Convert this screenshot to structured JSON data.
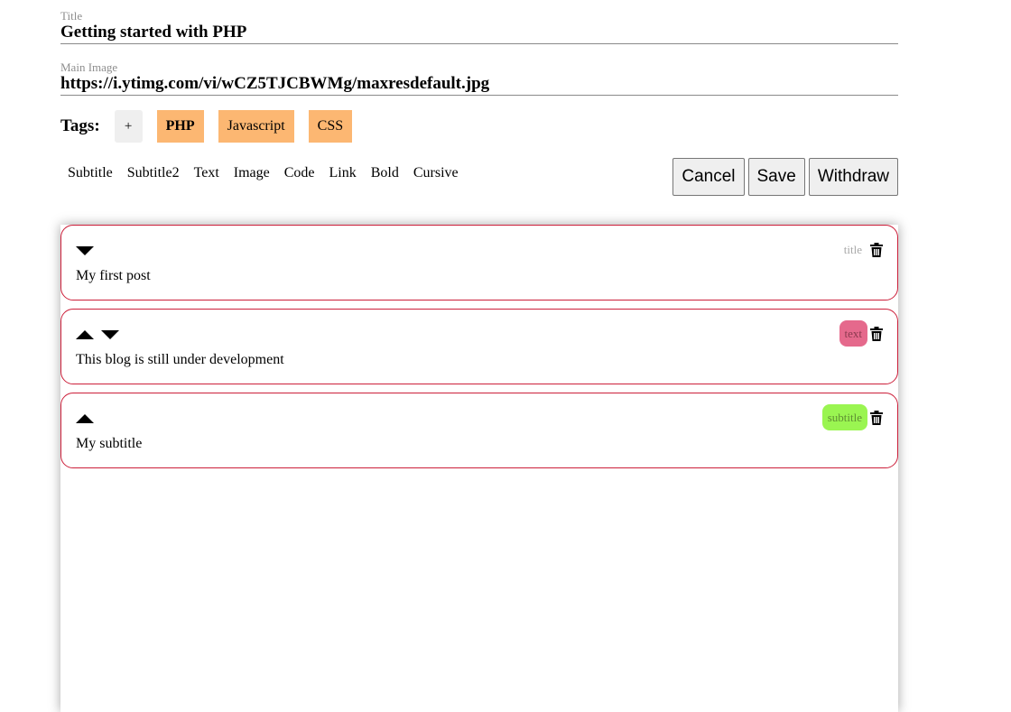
{
  "form": {
    "title_label": "Title",
    "title_value": "Getting started with PHP",
    "image_label": "Main Image",
    "image_value": "https://i.ytimg.com/vi/wCZ5TJCBWMg/maxresdefault.jpg"
  },
  "tags": {
    "label": "Tags:",
    "add_label": "+",
    "items": [
      "PHP",
      "Javascript",
      "CSS"
    ],
    "selected": "PHP",
    "color": "#fcb772"
  },
  "toolbar": {
    "items": [
      "Subtitle",
      "Subtitle2",
      "Text",
      "Image",
      "Code",
      "Link",
      "Bold",
      "Cursive"
    ]
  },
  "actions": {
    "cancel": "Cancel",
    "save": "Save",
    "withdraw": "Withdraw"
  },
  "blocks": [
    {
      "content": "My first post",
      "type": "title",
      "arrows": [
        "down"
      ]
    },
    {
      "content": "This blog is still under development",
      "type": "text",
      "arrows": [
        "up",
        "down"
      ],
      "badge_color": "#e5698c"
    },
    {
      "content": "My subtitle",
      "type": "subtitle",
      "arrows": [
        "up"
      ],
      "badge_color": "#9af551"
    }
  ],
  "icons": {
    "move_up": "caret-up-icon",
    "move_down": "caret-down-icon",
    "delete": "trash-icon"
  },
  "colors": {
    "block_border": "#cc1f3a"
  }
}
